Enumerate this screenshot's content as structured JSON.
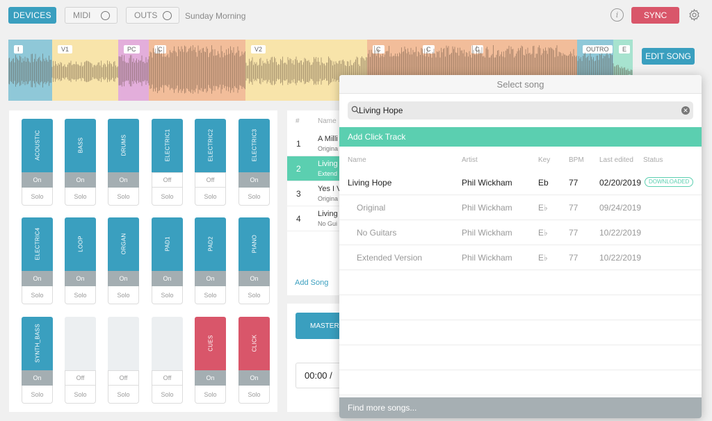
{
  "topbar": {
    "devices_label": "DEVICES",
    "midi_label": "MIDI",
    "outs_label": "OUTS",
    "set_name": "Sunday Morning",
    "info_glyph": "i",
    "sync_label": "SYNC"
  },
  "waveform": {
    "sections": [
      {
        "label": "I",
        "color": "#8fc8d8"
      },
      {
        "label": "V1",
        "color": "#f8e4aa"
      },
      {
        "label": "PC",
        "color": "#e3aedb"
      },
      {
        "label": "C",
        "color": "#f2bd9a"
      },
      {
        "label": "V2",
        "color": "#f8e4aa"
      },
      {
        "label": "C",
        "color": "#f2bd9a"
      },
      {
        "label": "C",
        "color": "#f2bd9a"
      },
      {
        "label": "C",
        "color": "#f2bd9a"
      },
      {
        "label": "OUTRO",
        "color": "#8fc8d8"
      },
      {
        "label": "E",
        "color": "#a7e3cf"
      }
    ],
    "edit_label": "EDIT SONG"
  },
  "mixer": {
    "channels": [
      {
        "name": "ACOUSTIC",
        "state": "On",
        "solo": "Solo",
        "style": "blue"
      },
      {
        "name": "BASS",
        "state": "On",
        "solo": "Solo",
        "style": "blue"
      },
      {
        "name": "DRUMS",
        "state": "On",
        "solo": "Solo",
        "style": "blue"
      },
      {
        "name": "ELECTRIC1",
        "state": "Off",
        "solo": "Solo",
        "style": "blue"
      },
      {
        "name": "ELECTRIC2",
        "state": "Off",
        "solo": "Solo",
        "style": "blue"
      },
      {
        "name": "ELECTRIC3",
        "state": "On",
        "solo": "Solo",
        "style": "blue"
      },
      {
        "name": "ELECTRIC4",
        "state": "On",
        "solo": "Solo",
        "style": "blue"
      },
      {
        "name": "LOOP",
        "state": "On",
        "solo": "Solo",
        "style": "blue"
      },
      {
        "name": "ORGAN",
        "state": "On",
        "solo": "Solo",
        "style": "blue"
      },
      {
        "name": "PAD1",
        "state": "On",
        "solo": "Solo",
        "style": "blue"
      },
      {
        "name": "PAD2",
        "state": "On",
        "solo": "Solo",
        "style": "blue"
      },
      {
        "name": "PIANO",
        "state": "On",
        "solo": "Solo",
        "style": "blue"
      },
      {
        "name": "SYNTH_BASS",
        "state": "On",
        "solo": "Solo",
        "style": "blue"
      },
      {
        "name": "",
        "state": "Off",
        "solo": "Solo",
        "style": "empty"
      },
      {
        "name": "",
        "state": "Off",
        "solo": "Solo",
        "style": "empty"
      },
      {
        "name": "",
        "state": "Off",
        "solo": "Solo",
        "style": "empty"
      },
      {
        "name": "CUES",
        "state": "On",
        "solo": "Solo",
        "style": "red"
      },
      {
        "name": "CLICK",
        "state": "On",
        "solo": "Solo",
        "style": "red"
      }
    ]
  },
  "setlist": {
    "header_num": "#",
    "header_name": "Name",
    "rows": [
      {
        "num": "1",
        "title": "A Milli",
        "subtitle": "Origina",
        "selected": false
      },
      {
        "num": "2",
        "title": "Living",
        "subtitle": "Extend",
        "selected": true
      },
      {
        "num": "3",
        "title": "Yes I V",
        "subtitle": "Origina",
        "selected": false
      },
      {
        "num": "4",
        "title": "Living",
        "subtitle": "No Gui",
        "selected": false
      }
    ],
    "add_song_label": "Add Song",
    "master_label": "MASTER",
    "time": "00:00 /"
  },
  "popup": {
    "title": "Select song",
    "search_value": "Living Hope",
    "add_click_label": "Add Click Track",
    "columns": {
      "name": "Name",
      "artist": "Artist",
      "key": "Key",
      "bpm": "BPM",
      "edited": "Last edited",
      "status": "Status"
    },
    "rows": [
      {
        "name": "Living Hope",
        "artist": "Phil Wickham",
        "key": "Eb",
        "bpm": "77",
        "edited": "02/20/2019",
        "status": "DOWNLOADED",
        "main": true
      },
      {
        "name": "Original",
        "artist": "Phil Wickham",
        "key": "E♭",
        "bpm": "77",
        "edited": "09/24/2019",
        "status": "",
        "main": false
      },
      {
        "name": "No Guitars",
        "artist": "Phil Wickham",
        "key": "E♭",
        "bpm": "77",
        "edited": "10/22/2019",
        "status": "",
        "main": false
      },
      {
        "name": "Extended Version",
        "artist": "Phil Wickham",
        "key": "E♭",
        "bpm": "77",
        "edited": "10/22/2019",
        "status": "",
        "main": false
      }
    ],
    "find_more_label": "Find more songs..."
  },
  "colors": {
    "accent": "#3a9fbf",
    "teal": "#5bcfb0",
    "red": "#d9566a",
    "gray": "#a6afb3"
  }
}
